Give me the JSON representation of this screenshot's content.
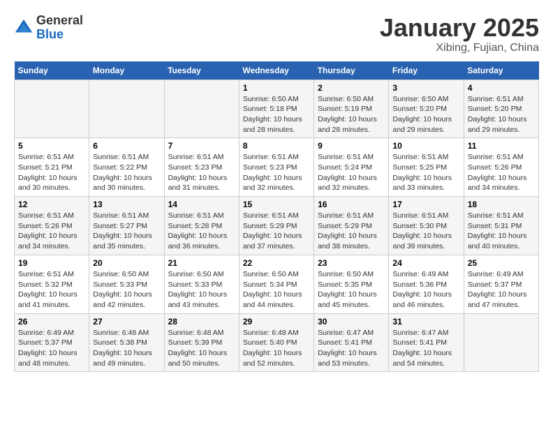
{
  "header": {
    "logo_general": "General",
    "logo_blue": "Blue",
    "month_title": "January 2025",
    "location": "Xibing, Fujian, China"
  },
  "days_of_week": [
    "Sunday",
    "Monday",
    "Tuesday",
    "Wednesday",
    "Thursday",
    "Friday",
    "Saturday"
  ],
  "weeks": [
    [
      {
        "day": "",
        "info": ""
      },
      {
        "day": "",
        "info": ""
      },
      {
        "day": "",
        "info": ""
      },
      {
        "day": "1",
        "info": "Sunrise: 6:50 AM\nSunset: 5:18 PM\nDaylight: 10 hours\nand 28 minutes."
      },
      {
        "day": "2",
        "info": "Sunrise: 6:50 AM\nSunset: 5:19 PM\nDaylight: 10 hours\nand 28 minutes."
      },
      {
        "day": "3",
        "info": "Sunrise: 6:50 AM\nSunset: 5:20 PM\nDaylight: 10 hours\nand 29 minutes."
      },
      {
        "day": "4",
        "info": "Sunrise: 6:51 AM\nSunset: 5:20 PM\nDaylight: 10 hours\nand 29 minutes."
      }
    ],
    [
      {
        "day": "5",
        "info": "Sunrise: 6:51 AM\nSunset: 5:21 PM\nDaylight: 10 hours\nand 30 minutes."
      },
      {
        "day": "6",
        "info": "Sunrise: 6:51 AM\nSunset: 5:22 PM\nDaylight: 10 hours\nand 30 minutes."
      },
      {
        "day": "7",
        "info": "Sunrise: 6:51 AM\nSunset: 5:23 PM\nDaylight: 10 hours\nand 31 minutes."
      },
      {
        "day": "8",
        "info": "Sunrise: 6:51 AM\nSunset: 5:23 PM\nDaylight: 10 hours\nand 32 minutes."
      },
      {
        "day": "9",
        "info": "Sunrise: 6:51 AM\nSunset: 5:24 PM\nDaylight: 10 hours\nand 32 minutes."
      },
      {
        "day": "10",
        "info": "Sunrise: 6:51 AM\nSunset: 5:25 PM\nDaylight: 10 hours\nand 33 minutes."
      },
      {
        "day": "11",
        "info": "Sunrise: 6:51 AM\nSunset: 5:26 PM\nDaylight: 10 hours\nand 34 minutes."
      }
    ],
    [
      {
        "day": "12",
        "info": "Sunrise: 6:51 AM\nSunset: 5:26 PM\nDaylight: 10 hours\nand 34 minutes."
      },
      {
        "day": "13",
        "info": "Sunrise: 6:51 AM\nSunset: 5:27 PM\nDaylight: 10 hours\nand 35 minutes."
      },
      {
        "day": "14",
        "info": "Sunrise: 6:51 AM\nSunset: 5:28 PM\nDaylight: 10 hours\nand 36 minutes."
      },
      {
        "day": "15",
        "info": "Sunrise: 6:51 AM\nSunset: 5:29 PM\nDaylight: 10 hours\nand 37 minutes."
      },
      {
        "day": "16",
        "info": "Sunrise: 6:51 AM\nSunset: 5:29 PM\nDaylight: 10 hours\nand 38 minutes."
      },
      {
        "day": "17",
        "info": "Sunrise: 6:51 AM\nSunset: 5:30 PM\nDaylight: 10 hours\nand 39 minutes."
      },
      {
        "day": "18",
        "info": "Sunrise: 6:51 AM\nSunset: 5:31 PM\nDaylight: 10 hours\nand 40 minutes."
      }
    ],
    [
      {
        "day": "19",
        "info": "Sunrise: 6:51 AM\nSunset: 5:32 PM\nDaylight: 10 hours\nand 41 minutes."
      },
      {
        "day": "20",
        "info": "Sunrise: 6:50 AM\nSunset: 5:33 PM\nDaylight: 10 hours\nand 42 minutes."
      },
      {
        "day": "21",
        "info": "Sunrise: 6:50 AM\nSunset: 5:33 PM\nDaylight: 10 hours\nand 43 minutes."
      },
      {
        "day": "22",
        "info": "Sunrise: 6:50 AM\nSunset: 5:34 PM\nDaylight: 10 hours\nand 44 minutes."
      },
      {
        "day": "23",
        "info": "Sunrise: 6:50 AM\nSunset: 5:35 PM\nDaylight: 10 hours\nand 45 minutes."
      },
      {
        "day": "24",
        "info": "Sunrise: 6:49 AM\nSunset: 5:36 PM\nDaylight: 10 hours\nand 46 minutes."
      },
      {
        "day": "25",
        "info": "Sunrise: 6:49 AM\nSunset: 5:37 PM\nDaylight: 10 hours\nand 47 minutes."
      }
    ],
    [
      {
        "day": "26",
        "info": "Sunrise: 6:49 AM\nSunset: 5:37 PM\nDaylight: 10 hours\nand 48 minutes."
      },
      {
        "day": "27",
        "info": "Sunrise: 6:48 AM\nSunset: 5:38 PM\nDaylight: 10 hours\nand 49 minutes."
      },
      {
        "day": "28",
        "info": "Sunrise: 6:48 AM\nSunset: 5:39 PM\nDaylight: 10 hours\nand 50 minutes."
      },
      {
        "day": "29",
        "info": "Sunrise: 6:48 AM\nSunset: 5:40 PM\nDaylight: 10 hours\nand 52 minutes."
      },
      {
        "day": "30",
        "info": "Sunrise: 6:47 AM\nSunset: 5:41 PM\nDaylight: 10 hours\nand 53 minutes."
      },
      {
        "day": "31",
        "info": "Sunrise: 6:47 AM\nSunset: 5:41 PM\nDaylight: 10 hours\nand 54 minutes."
      },
      {
        "day": "",
        "info": ""
      }
    ]
  ]
}
